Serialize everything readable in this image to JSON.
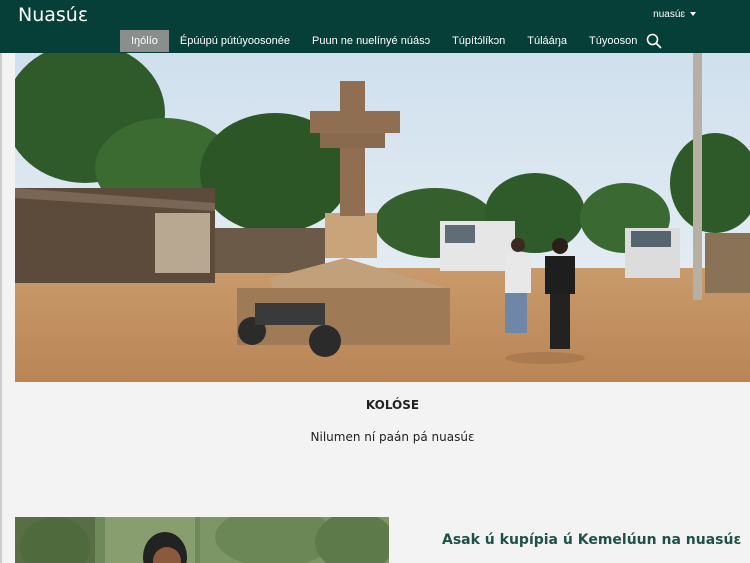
{
  "header": {
    "brand": "Nuasúɛ",
    "language": "nuasúɛ"
  },
  "nav": {
    "items": [
      "Iŋólío",
      "Épúúpú pútúyoosonée",
      "Puun ne nuelínyé núásɔ",
      "Túpítɔ́líkɔn",
      "Túlááŋa",
      "Túyooson"
    ]
  },
  "hero": {
    "title": "KOLÓSE",
    "subtitle": "Nilumen ní paán pá nuasúɛ"
  },
  "section": {
    "title": "Asak ú kupípia ú Kemelúun na nuasúɛ"
  },
  "colors": {
    "topbar": "#063f37",
    "nav_active": "#8a8f8d",
    "section_title": "#1f5148"
  },
  "icons": {
    "search": "search-icon",
    "dropdown": "caret-down-icon"
  }
}
